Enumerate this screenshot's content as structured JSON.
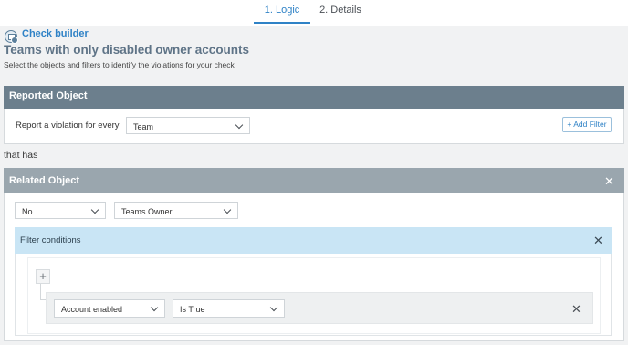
{
  "tabs": [
    {
      "label": "1. Logic",
      "active": true
    },
    {
      "label": "2. Details",
      "active": false
    }
  ],
  "header": {
    "app_title": "Check builder",
    "page_title": "Teams with only disabled owner accounts",
    "subtitle": "Select the objects and filters to identify the violations for your check"
  },
  "reported_object": {
    "heading": "Reported Object",
    "label": "Report a violation for every",
    "object_value": "Team",
    "add_filter_label": "+ Add Filter"
  },
  "connector_text": "that has",
  "related_object": {
    "heading": "Related Object",
    "quantifier_value": "No",
    "object_value": "Teams Owner",
    "filter_conditions": {
      "heading": "Filter conditions",
      "add_symbol": "+",
      "conditions": [
        {
          "field": "Account enabled",
          "operator": "Is True"
        }
      ]
    }
  },
  "colors": {
    "accent": "#2f82c6",
    "reported_header": "#6c7f8d",
    "related_header": "#9aa6ae",
    "filter_header": "#c9e5f5"
  },
  "icons": {
    "check_builder": "check-builder-icon",
    "close": "close-icon",
    "chevron": "chevron-down-icon",
    "plus": "plus-icon"
  }
}
